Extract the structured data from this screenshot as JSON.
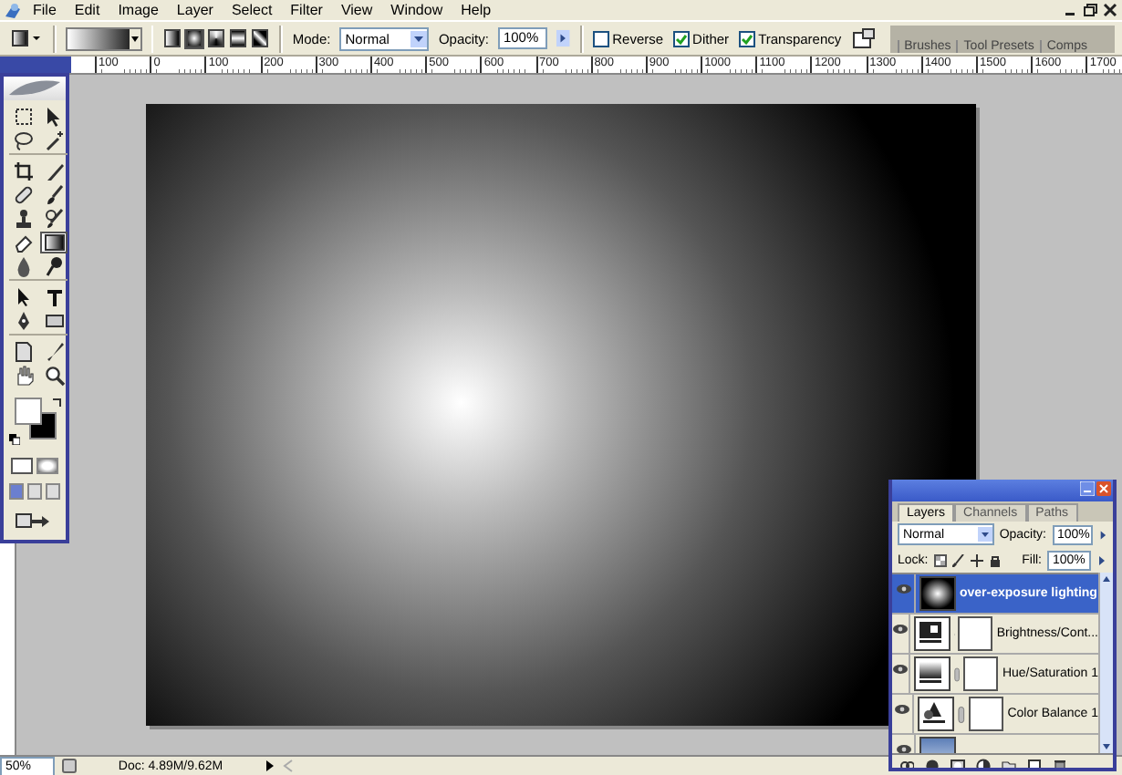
{
  "menu": [
    "File",
    "Edit",
    "Image",
    "Layer",
    "Select",
    "Filter",
    "View",
    "Window",
    "Help"
  ],
  "options": {
    "gradient_types": [
      {
        "selected": false
      },
      {
        "selected": true
      },
      {
        "selected": false
      },
      {
        "selected": false
      },
      {
        "selected": false
      }
    ],
    "mode_label": "Mode:",
    "mode": "Normal",
    "opacity_label": "Opacity:",
    "opacity": "100%",
    "checkboxes": [
      {
        "label": "Reverse",
        "checked": false
      },
      {
        "label": "Dither",
        "checked": true
      },
      {
        "label": "Transparency",
        "checked": true
      }
    ],
    "palette_tabs": [
      "Brushes",
      "Tool Presets",
      "Comps"
    ]
  },
  "ruler": [
    "100",
    "0",
    "100",
    "200",
    "300",
    "400",
    "500",
    "600",
    "700",
    "800",
    "900",
    "1000",
    "1100",
    "1200",
    "1300",
    "1400",
    "1500",
    "1600",
    "1700"
  ],
  "toolbox": {
    "tools": [
      {
        "selected": false
      },
      {
        "selected": false
      },
      {
        "selected": false
      },
      {
        "selected": false
      },
      {
        "selected": false
      },
      {
        "selected": false
      },
      {
        "selected": false
      },
      {
        "selected": false
      },
      {
        "selected": false
      },
      {
        "selected": false
      },
      {
        "selected": false
      },
      {
        "selected": true
      },
      {
        "selected": false
      },
      {
        "selected": false
      },
      {
        "selected": false
      },
      {
        "selected": false
      },
      {
        "selected": false
      },
      {
        "selected": false
      },
      {
        "selected": false
      },
      {
        "selected": false
      },
      {
        "selected": false
      },
      {
        "selected": false
      }
    ]
  },
  "layers_panel": {
    "tabs": [
      {
        "label": "Layers",
        "selected": true
      },
      {
        "label": "Channels",
        "selected": false
      },
      {
        "label": "Paths",
        "selected": false
      }
    ],
    "blend_mode": "Normal",
    "opacity_label": "Opacity:",
    "opacity": "100%",
    "lock_label": "Lock:",
    "fill_label": "Fill:",
    "fill": "100%",
    "layers": [
      {
        "kind": "gradient",
        "name": "over-exposure lighting",
        "selected": true,
        "visible": true
      },
      {
        "kind": "brightness",
        "name": "Brightness/Cont...",
        "selected": false,
        "visible": true
      },
      {
        "kind": "hue-saturation",
        "name": "Hue/Saturation 1",
        "selected": false,
        "visible": true
      },
      {
        "kind": "color-balance",
        "name": "Color Balance 1",
        "selected": false,
        "visible": true
      },
      {
        "kind": "photo",
        "selected": false,
        "visible": true
      }
    ]
  },
  "status_bar": {
    "zoom": "50%",
    "doc": "Doc: 4.89M/9.62M"
  }
}
